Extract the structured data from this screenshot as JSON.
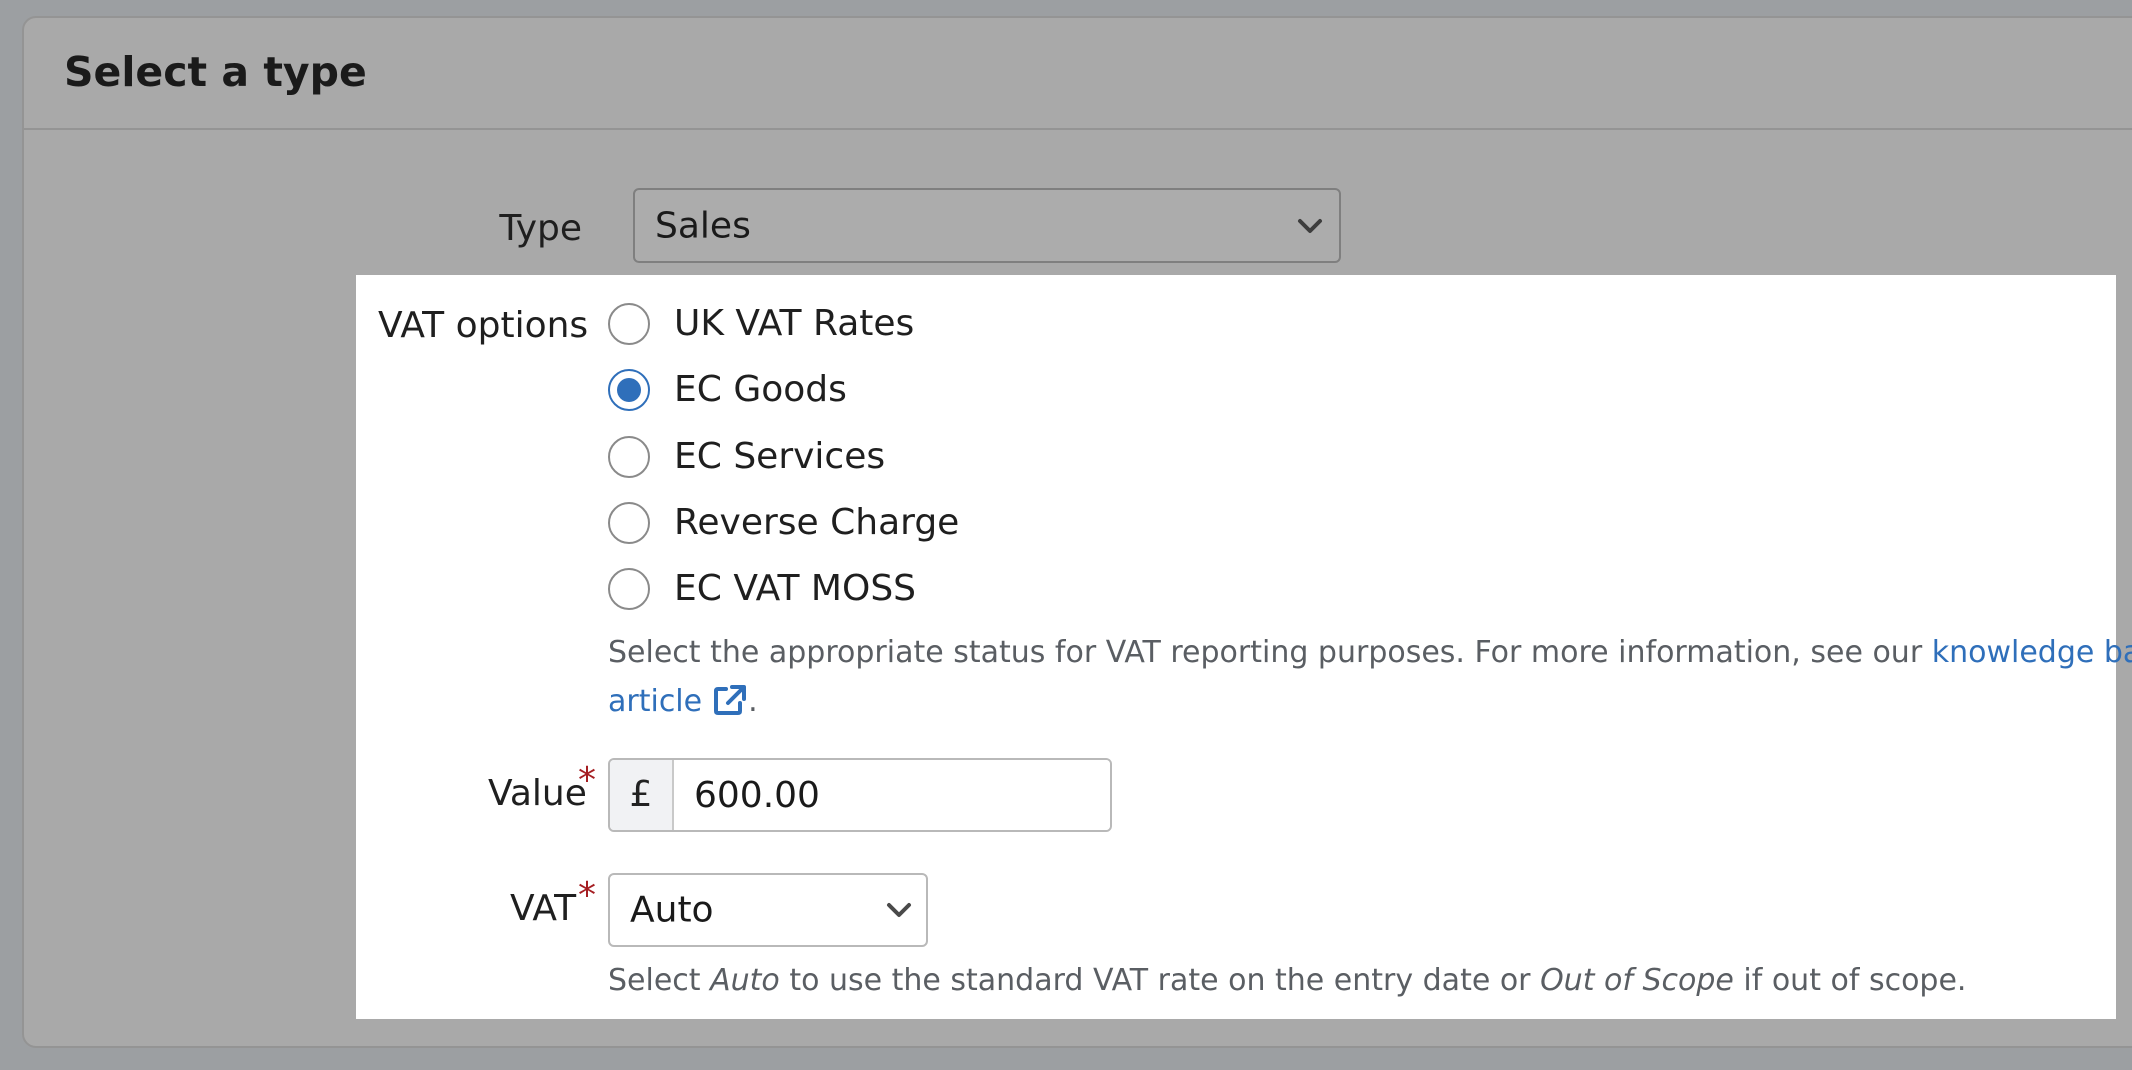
{
  "panel": {
    "title": "Select a type"
  },
  "type_field": {
    "label": "Type",
    "selected": "Sales"
  },
  "vat_options": {
    "label": "VAT options",
    "options": [
      {
        "label": "UK VAT Rates",
        "checked": false
      },
      {
        "label": "EC Goods",
        "checked": true
      },
      {
        "label": "EC Services",
        "checked": false
      },
      {
        "label": "Reverse Charge",
        "checked": false
      },
      {
        "label": "EC VAT MOSS",
        "checked": false
      }
    ],
    "help_prefix": "Select the appropriate status for VAT reporting purposes. For more information, see our",
    "help_link_part1": "knowledge base",
    "help_link_part2": "article",
    "help_suffix": "."
  },
  "value_field": {
    "label": "Value",
    "required_mark": "*",
    "currency_symbol": "£",
    "value": "600.00"
  },
  "vat_field": {
    "label": "VAT",
    "required_mark": "*",
    "selected": "Auto",
    "help_pre": "Select",
    "help_auto": "Auto",
    "help_mid": "to use the standard VAT rate on the entry date or",
    "help_oos": "Out of Scope",
    "help_post": "if out of scope."
  },
  "colors": {
    "accent": "#2f6fba",
    "required": "#a51e22",
    "overlay": "#a9a9a9"
  }
}
